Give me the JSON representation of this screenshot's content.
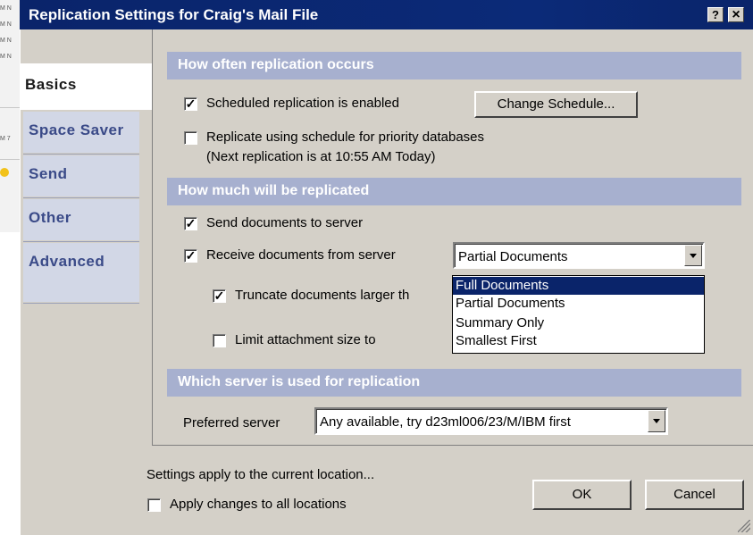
{
  "background": {
    "left_strip_texts": [
      "M N",
      "M N",
      "M N",
      "M N",
      "M 7"
    ]
  },
  "dialog": {
    "title": "Replication Settings for Craig's Mail File",
    "help_button": "?",
    "close_button": "×"
  },
  "tabs": [
    {
      "label": "Basics",
      "selected": true
    },
    {
      "label": "Space Saver",
      "selected": false
    },
    {
      "label": "Send",
      "selected": false
    },
    {
      "label": "Other",
      "selected": false
    },
    {
      "label": "Advanced",
      "selected": false
    }
  ],
  "sections": {
    "frequency": {
      "heading": "How often replication occurs",
      "scheduled_enabled": {
        "checked": true,
        "label": "Scheduled replication is enabled",
        "accel": "e"
      },
      "change_schedule_button": "Change Schedule...",
      "priority_schedule": {
        "checked": false,
        "label": "Replicate using schedule for priority databases",
        "accel": "p"
      },
      "next_replication": "(Next replication is at 10:55 AM Today)"
    },
    "amount": {
      "heading": "How much will be replicated",
      "send_documents": {
        "checked": true,
        "label": "Send documents to server",
        "accel": "S"
      },
      "receive_documents": {
        "checked": true,
        "label": "Receive documents from server",
        "accel": "R"
      },
      "receive_mode": "Partial Documents",
      "truncate_documents": {
        "checked": true,
        "label": "Truncate documents larger th",
        "accel": "T"
      },
      "limit_attachment": {
        "checked": false,
        "label": "Limit attachment size to",
        "accel": "a"
      },
      "receive_mode_options": [
        {
          "label": "Full Documents",
          "highlighted": true
        },
        {
          "label": "Partial Documents",
          "highlighted": false
        },
        {
          "label": "Summary Only",
          "highlighted": false
        },
        {
          "label": "Smallest First",
          "highlighted": false
        }
      ]
    },
    "server": {
      "heading": "Which server is used for replication",
      "preferred_label": "Preferred server",
      "preferred_accel": "v",
      "preferred_value": "Any available, try d23ml006/23/M/IBM first"
    }
  },
  "footer": {
    "note": "Settings apply to the current location...",
    "apply_all": {
      "checked": false,
      "label": "Apply changes to all locations"
    },
    "ok_button": "OK",
    "cancel_button": "Cancel"
  },
  "colors": {
    "title_bar": "#0a246a",
    "section_band": "#a7b0cf",
    "tab_inactive": "#d2d7e6",
    "selection": "#0a246a",
    "dialog_face": "#d4d0c8"
  }
}
